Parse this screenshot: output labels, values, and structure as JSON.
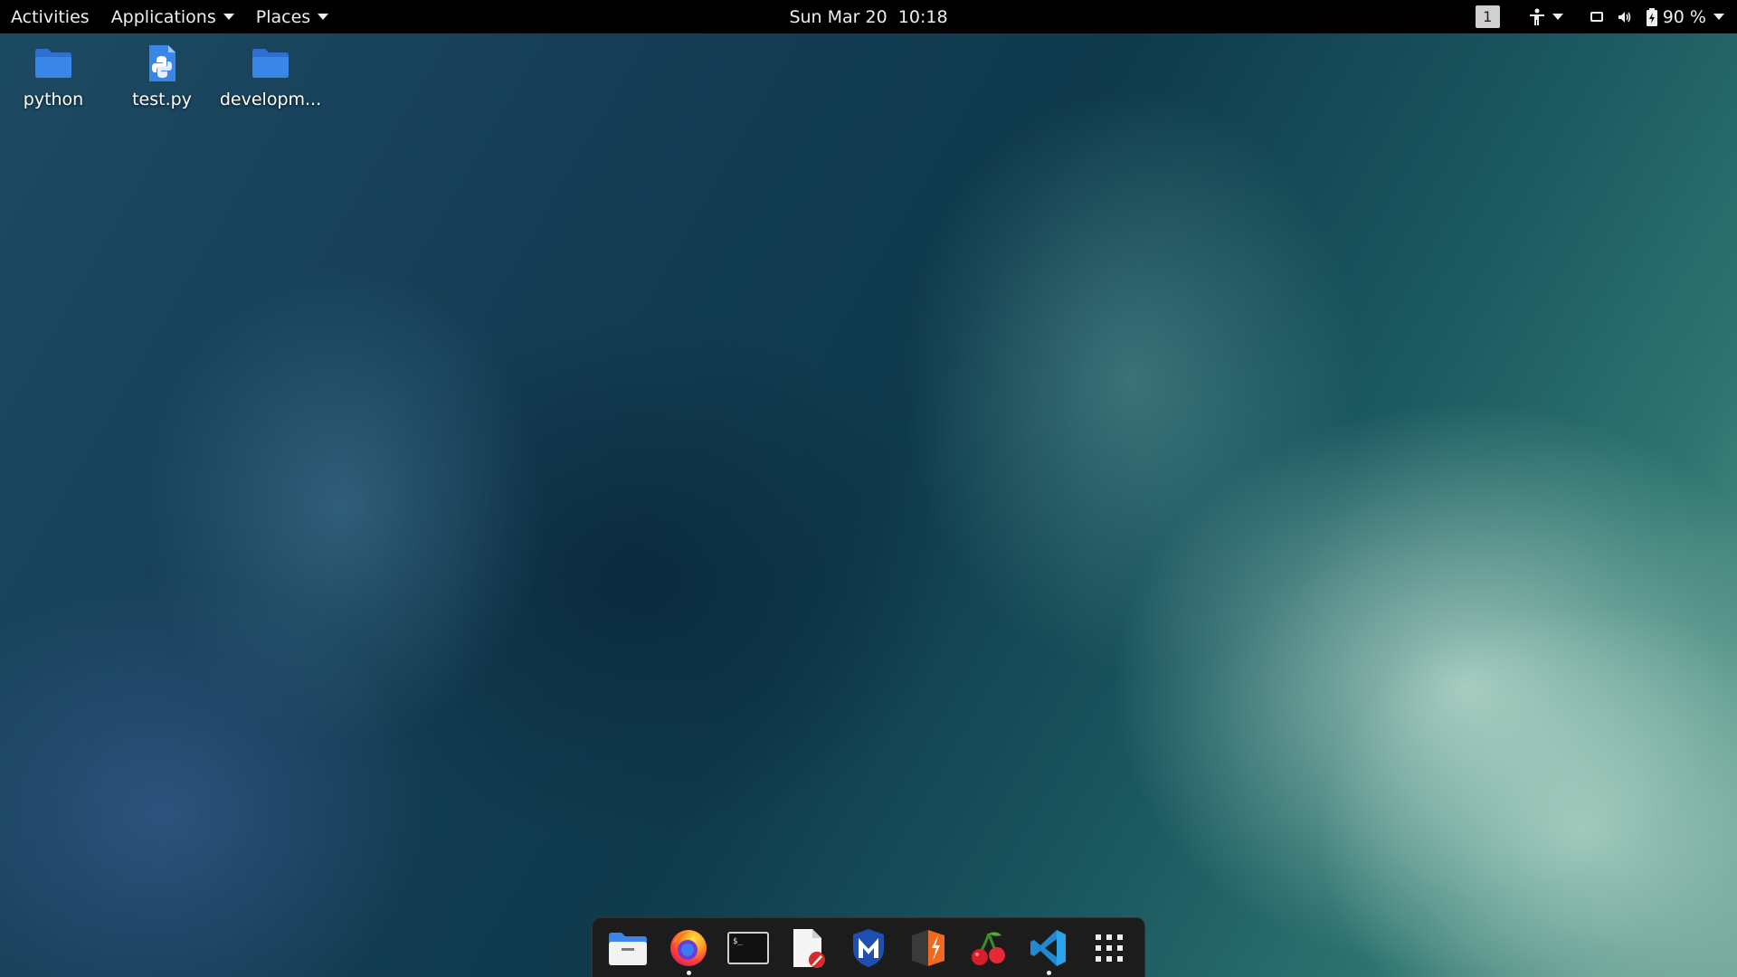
{
  "topbar": {
    "activities": "Activities",
    "applications": "Applications",
    "places": "Places",
    "clock": "Sun Mar 20  10:18",
    "workspace": "1",
    "battery": "90 %"
  },
  "desktop": {
    "icons": [
      {
        "label": "python",
        "icon": "folder-icon"
      },
      {
        "label": "test.py",
        "icon": "python-file-icon"
      },
      {
        "label": "developm...",
        "icon": "folder-icon"
      }
    ]
  },
  "dock": {
    "apps": [
      {
        "name": "Files",
        "icon": "files-icon",
        "running": false
      },
      {
        "name": "Firefox",
        "icon": "firefox-icon",
        "running": true
      },
      {
        "name": "Terminal",
        "icon": "terminal-icon",
        "running": false
      },
      {
        "name": "Text Editor",
        "icon": "text-editor-icon",
        "running": false
      },
      {
        "name": "Maltego",
        "icon": "maltego-icon",
        "running": false
      },
      {
        "name": "Burp Suite",
        "icon": "burp-icon",
        "running": false
      },
      {
        "name": "Cherrytree",
        "icon": "cherry-icon",
        "running": false
      },
      {
        "name": "Visual Studio Code",
        "icon": "vscode-icon",
        "running": true
      },
      {
        "name": "Show Applications",
        "icon": "app-grid-icon",
        "running": false
      }
    ]
  },
  "colors": {
    "folder": "#3a86e8",
    "topbar": "#000000",
    "dock": "#1c1c1c"
  }
}
